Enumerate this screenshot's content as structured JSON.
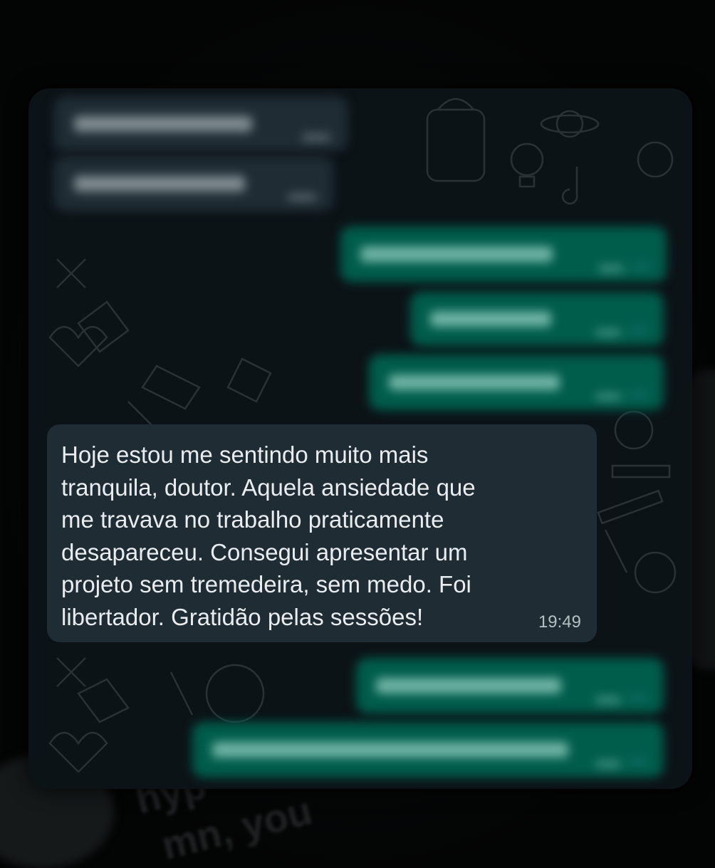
{
  "chat": {
    "incoming_message": {
      "text": "Hoje estou me sentindo muito mais\ntranquila, doutor. Aquela ansiedade que\nme travava no trabalho praticamente\ndesapareceu. Consegui apresentar um\nprojeto sem tremedeira, sem medo. Foi\nlibertador. Gratidão pelas sessões!",
      "time": "19:49"
    }
  },
  "background_text": {
    "bottom_line_1": "hyp",
    "bottom_line_2": "mn, you"
  },
  "colors": {
    "chat_background": "#0c1317",
    "incoming_bubble": "#1f2c34",
    "outgoing_bubble": "#005c4b",
    "message_text": "#e9edef",
    "read_receipt": "#53bdeb"
  },
  "icons": [
    "double-check-icon",
    "doodle-pattern"
  ]
}
